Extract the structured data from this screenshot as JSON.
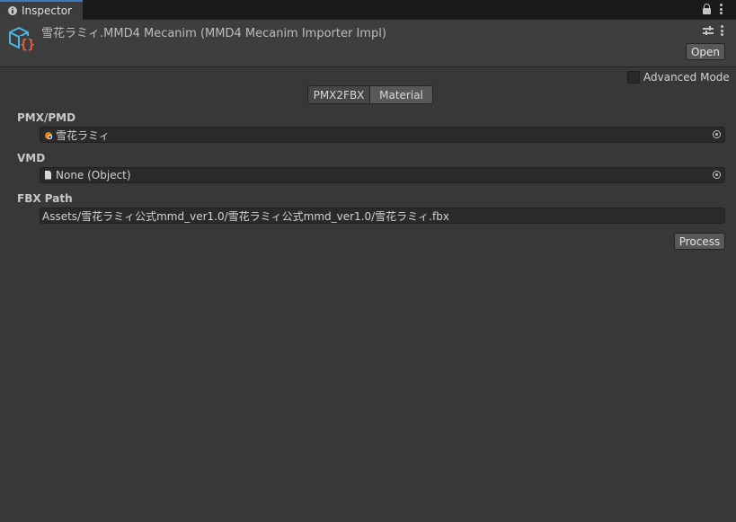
{
  "tab": {
    "label": "Inspector"
  },
  "header": {
    "title": "雪花ラミィ.MMD4 Mecanim (MMD4 Mecanim Importer Impl)",
    "open_label": "Open"
  },
  "advanced_mode": {
    "label": "Advanced Mode",
    "checked": false
  },
  "toolbar": {
    "tabs": [
      {
        "label": "PMX2FBX",
        "selected": true
      },
      {
        "label": "Material",
        "selected": false
      }
    ]
  },
  "fields": {
    "pmx": {
      "label": "PMX/PMD",
      "value": "雪花ラミィ"
    },
    "vmd": {
      "label": "VMD",
      "value": "None (Object)"
    },
    "fbx": {
      "label": "FBX Path",
      "value": "Assets/雪花ラミィ公式mmd_ver1.0/雪花ラミィ公式mmd_ver1.0/雪花ラミィ.fbx"
    }
  },
  "process_label": "Process",
  "colors": {
    "background": "#383838",
    "tab_accent": "#3a79bb",
    "icon_cube": "#4fb3e8",
    "icon_braces": "#e8653a"
  }
}
